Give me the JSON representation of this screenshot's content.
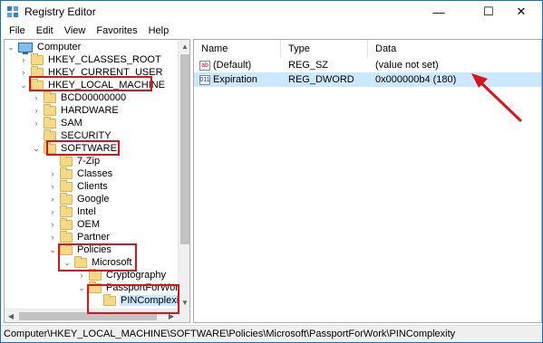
{
  "window": {
    "title": "Registry Editor",
    "icon": "registry-icon",
    "controls": {
      "minimize": "—",
      "maximize": "☐",
      "close": "✕"
    }
  },
  "menu": [
    "File",
    "Edit",
    "View",
    "Favorites",
    "Help"
  ],
  "tree": {
    "items": [
      {
        "label": "Computer",
        "twisty": "⌄",
        "icon": "computer-icon"
      },
      {
        "label": "HKEY_CLASSES_ROOT",
        "twisty": "›"
      },
      {
        "label": "HKEY_CURRENT_USER",
        "twisty": "›"
      },
      {
        "label": "HKEY_LOCAL_MACHINE",
        "twisty": "⌄"
      },
      {
        "label": "BCD00000000",
        "twisty": "›"
      },
      {
        "label": "HARDWARE",
        "twisty": "›"
      },
      {
        "label": "SAM",
        "twisty": "›"
      },
      {
        "label": "SECURITY",
        "twisty": ""
      },
      {
        "label": "SOFTWARE",
        "twisty": "⌄"
      },
      {
        "label": "7-Zip",
        "twisty": ""
      },
      {
        "label": "Classes",
        "twisty": "›"
      },
      {
        "label": "Clients",
        "twisty": "›"
      },
      {
        "label": "Google",
        "twisty": "›"
      },
      {
        "label": "Intel",
        "twisty": "›"
      },
      {
        "label": "OEM",
        "twisty": "›"
      },
      {
        "label": "Partner",
        "twisty": "›"
      },
      {
        "label": "Policies",
        "twisty": "⌄"
      },
      {
        "label": "Microsoft",
        "twisty": "⌄"
      },
      {
        "label": "Cryptography",
        "twisty": "›"
      },
      {
        "label": "PassportForWork",
        "twisty": "⌄"
      },
      {
        "label": "PINComplexity",
        "twisty": "",
        "selected": true
      }
    ]
  },
  "list": {
    "columns": [
      "Name",
      "Type",
      "Data"
    ],
    "rows": [
      {
        "name": "(Default)",
        "type": "REG_SZ",
        "data": "(value not set)",
        "icon": "ab"
      },
      {
        "name": "Expiration",
        "type": "REG_DWORD",
        "data": "0x000000b4 (180)",
        "icon": "011",
        "selected": true
      }
    ]
  },
  "status": "Computer\\HKEY_LOCAL_MACHINE\\SOFTWARE\\Policies\\Microsoft\\PassportForWork\\PINComplexity",
  "colors": {
    "highlight": "#d9151b",
    "selection": "#cce8ff",
    "accent": "#1b6fc0"
  }
}
